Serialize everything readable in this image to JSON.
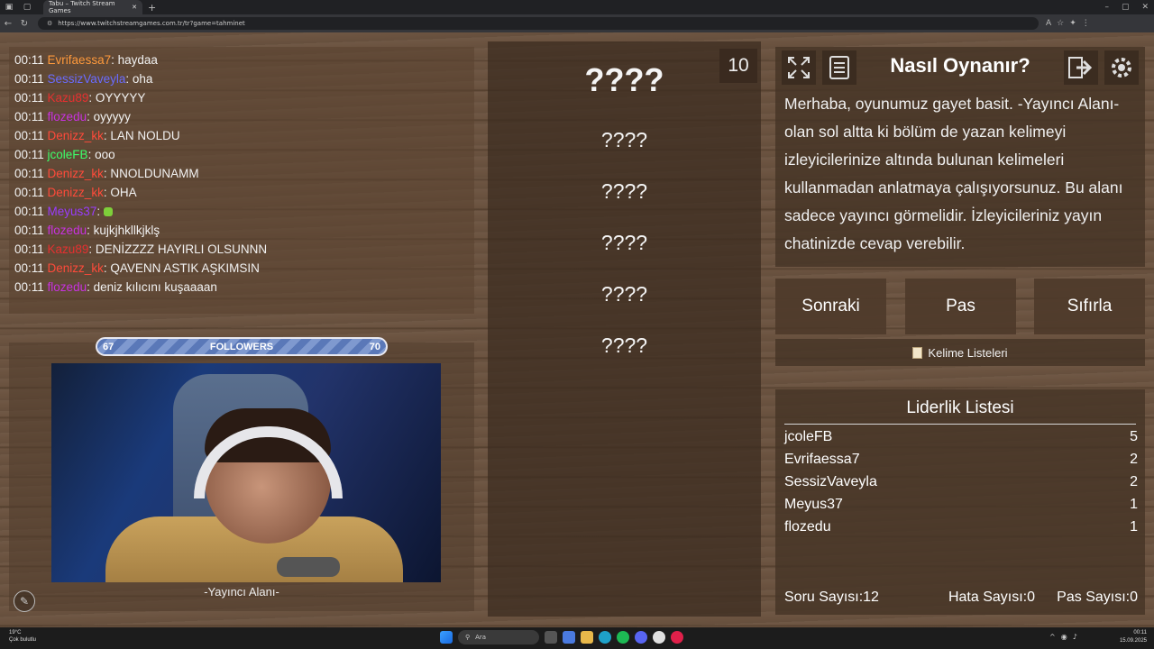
{
  "browser": {
    "tab_title": "Tabu – Twitch Stream Games",
    "url": "https://www.twitchstreamgames.com.tr/tr?game=tahminet"
  },
  "chat": [
    {
      "time": "00:11",
      "user": "Evrifaessa7",
      "color": "#ff9a3c",
      "msg": ": haydaa"
    },
    {
      "time": "00:11",
      "user": "SessizVaveyla",
      "color": "#6a6cff",
      "msg": ": oha"
    },
    {
      "time": "00:11",
      "user": "Kazu89",
      "color": "#e53030",
      "msg": ": OYYYYY"
    },
    {
      "time": "00:11",
      "user": "flozedu",
      "color": "#c832e0",
      "msg": ": oyyyyy"
    },
    {
      "time": "00:11",
      "user": "Denizz_kk",
      "color": "#ff4a3a",
      "msg": ": LAN NOLDU"
    },
    {
      "time": "00:11",
      "user": "jcoleFB",
      "color": "#3cff6a",
      "msg": ": ooo"
    },
    {
      "time": "00:11",
      "user": "Denizz_kk",
      "color": "#ff4a3a",
      "msg": ": NNOLDUNAMM"
    },
    {
      "time": "00:11",
      "user": "Denizz_kk",
      "color": "#ff4a3a",
      "msg": ": OHA"
    },
    {
      "time": "00:11",
      "user": "Meyus37",
      "color": "#9a3cff",
      "msg": ": "
    },
    {
      "time": "00:11",
      "user": "flozedu",
      "color": "#c832e0",
      "msg": ": kujkjhkllkjklş"
    },
    {
      "time": "00:11",
      "user": "Kazu89",
      "color": "#e53030",
      "msg": ": DENİZZZZ HAYIRLI OLSUNNN"
    },
    {
      "time": "00:11",
      "user": "Denizz_kk",
      "color": "#ff4a3a",
      "msg": ": QAVENN ASTIK AŞKIMSIN"
    },
    {
      "time": "00:11",
      "user": "flozedu",
      "color": "#c832e0",
      "msg": ": deniz kılıcını kuşaaaan"
    }
  ],
  "followers": {
    "current": "67",
    "label": "FOLLOWERS",
    "goal": "70",
    "progress": 0.85
  },
  "streamer_label": "-Yayıncı Alanı-",
  "game": {
    "timer": "10",
    "main_word": "????",
    "forbidden_words": [
      "????",
      "????",
      "????",
      "????",
      "????"
    ]
  },
  "howto": {
    "title": "Nasıl Oynanır?",
    "text": "Merhaba, oyunumuz gayet basit. -Yayıncı Alanı- olan sol altta ki bölüm de yazan kelimeyi izleyicilerinize altında bulunan kelimeleri kullanmadan anlatmaya çalışıyorsunuz. Bu alanı sadece yayıncı görmelidir. İzleyicileriniz yayın chatinizde cevap verebilir."
  },
  "buttons": {
    "next": "Sonraki",
    "pass": "Pas",
    "reset": "Sıfırla",
    "word_lists": "Kelime Listeleri"
  },
  "leaderboard": {
    "title": "Liderlik Listesi",
    "rows": [
      {
        "name": "jcoleFB",
        "score": "5"
      },
      {
        "name": "Evrifaessa7",
        "score": "2"
      },
      {
        "name": "SessizVaveyla",
        "score": "2"
      },
      {
        "name": "Meyus37",
        "score": "1"
      },
      {
        "name": "flozedu",
        "score": "1"
      }
    ]
  },
  "stats": {
    "questions": "Soru Sayısı:12",
    "errors": "Hata Sayısı:0",
    "passes": "Pas Sayısı:0"
  },
  "taskbar": {
    "weather_temp": "19°C",
    "weather_desc": "Çok bulutlu",
    "search": "Ara",
    "time": "00:11",
    "date": "15.09.2025"
  }
}
